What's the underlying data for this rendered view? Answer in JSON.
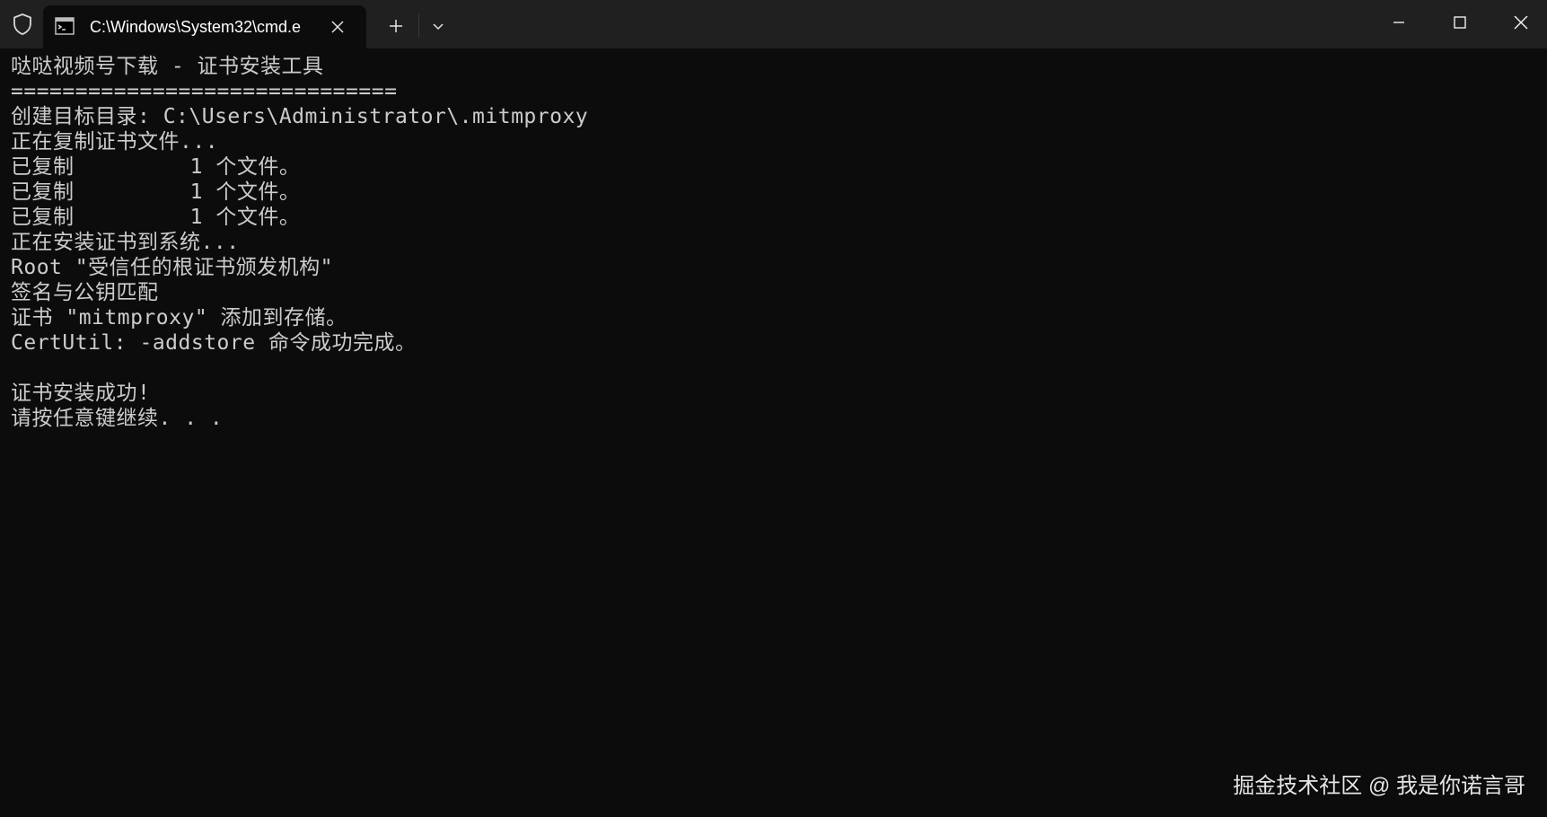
{
  "titlebar": {
    "tab_title": "C:\\Windows\\System32\\cmd.e",
    "icons": {
      "shield": "shield-icon",
      "terminal": "cmd-terminal-icon",
      "close_tab": "close-icon",
      "new_tab": "plus-icon",
      "dropdown": "chevron-down-icon",
      "minimize": "minimize-icon",
      "maximize": "maximize-icon",
      "close_window": "close-icon"
    }
  },
  "console": {
    "lines": [
      "哒哒视频号下载 - 证书安装工具",
      "==============================",
      "创建目标目录: C:\\Users\\Administrator\\.mitmproxy",
      "正在复制证书文件...",
      "已复制         1 个文件。",
      "已复制         1 个文件。",
      "已复制         1 个文件。",
      "正在安装证书到系统...",
      "Root \"受信任的根证书颁发机构\"",
      "签名与公钥匹配",
      "证书 \"mitmproxy\" 添加到存储。",
      "CertUtil: -addstore 命令成功完成。",
      "",
      "证书安装成功!",
      "请按任意键继续. . ."
    ]
  },
  "watermark": "掘金技术社区 @ 我是你诺言哥",
  "colors": {
    "titlebar_bg": "#202020",
    "console_bg": "#0c0c0c",
    "console_text": "#cccccc",
    "titlebar_text": "#ffffff"
  }
}
